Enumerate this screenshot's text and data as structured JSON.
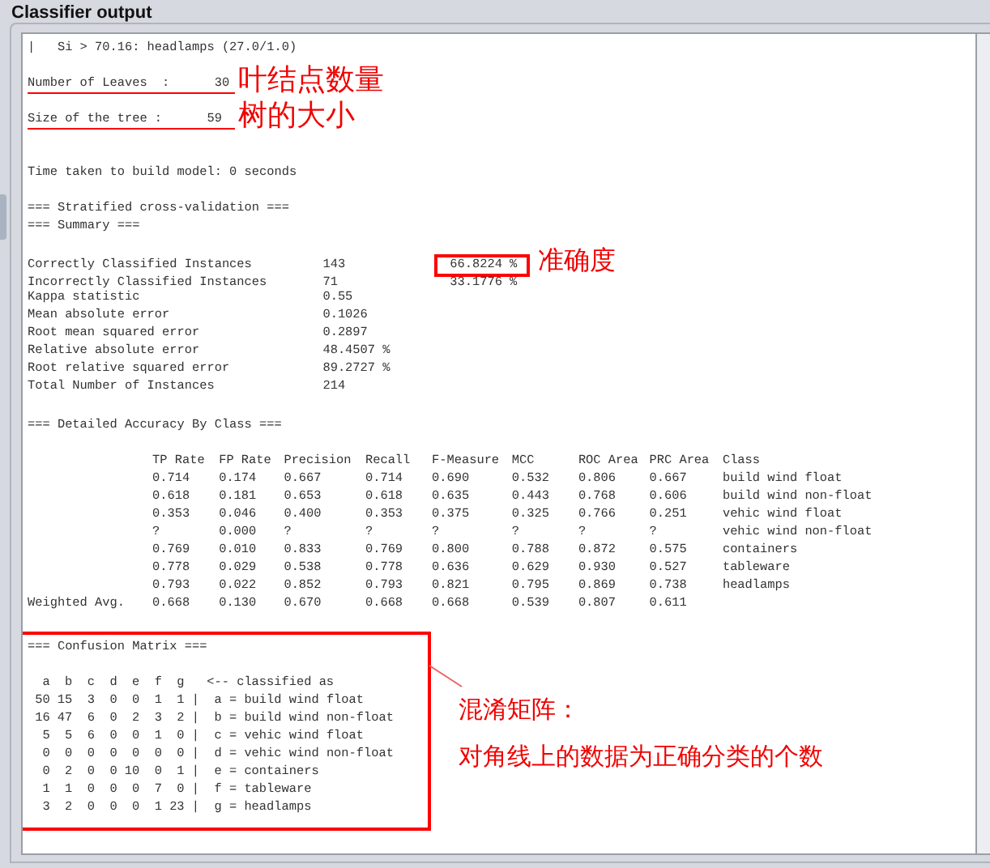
{
  "panel": {
    "title": "Classifier output"
  },
  "tree_lines": [
    "|   Si > 70.16: headlamps (27.0/1.0)"
  ],
  "tree_stats": [
    {
      "label": "Number of Leaves  :",
      "value": "30",
      "underlined": true,
      "note": "叶结点数量"
    },
    {
      "label": "Size of the tree :",
      "value": "59",
      "underlined": true,
      "note": "树的大小"
    }
  ],
  "build_time": "Time taken to build model: 0 seconds",
  "summary": {
    "headings": [
      "=== Stratified cross-validation ===",
      "=== Summary ==="
    ],
    "rows": [
      {
        "label": "Correctly Classified Instances",
        "value": "143",
        "percent": "66.8224 %",
        "highlighted": true
      },
      {
        "label": "Incorrectly Classified Instances",
        "value": "71",
        "percent": "33.1776 %",
        "highlighted": false
      },
      {
        "label": "Kappa statistic",
        "value": "0.55"
      },
      {
        "label": "Mean absolute error",
        "value": "0.1026"
      },
      {
        "label": "Root mean squared error",
        "value": "0.2897"
      },
      {
        "label": "Relative absolute error",
        "value": "48.4507 %"
      },
      {
        "label": "Root relative squared error",
        "value": "89.2727 %"
      },
      {
        "label": "Total Number of Instances",
        "value": "214"
      }
    ],
    "note": "准确度"
  },
  "detailed": {
    "heading": "=== Detailed Accuracy By Class ===",
    "columns": [
      "TP Rate",
      "FP Rate",
      "Precision",
      "Recall",
      "F-Measure",
      "MCC",
      "ROC Area",
      "PRC Area",
      "Class"
    ],
    "rows": [
      {
        "values": [
          "0.714",
          "0.174",
          "0.667",
          "0.714",
          "0.690",
          "0.532",
          "0.806",
          "0.667"
        ],
        "class": "build wind float"
      },
      {
        "values": [
          "0.618",
          "0.181",
          "0.653",
          "0.618",
          "0.635",
          "0.443",
          "0.768",
          "0.606"
        ],
        "class": "build wind non-float"
      },
      {
        "values": [
          "0.353",
          "0.046",
          "0.400",
          "0.353",
          "0.375",
          "0.325",
          "0.766",
          "0.251"
        ],
        "class": "vehic wind float"
      },
      {
        "values": [
          "?",
          "0.000",
          "?",
          "?",
          "?",
          "?",
          "?",
          "?"
        ],
        "class": "vehic wind non-float"
      },
      {
        "values": [
          "0.769",
          "0.010",
          "0.833",
          "0.769",
          "0.800",
          "0.788",
          "0.872",
          "0.575"
        ],
        "class": "containers"
      },
      {
        "values": [
          "0.778",
          "0.029",
          "0.538",
          "0.778",
          "0.636",
          "0.629",
          "0.930",
          "0.527"
        ],
        "class": "tableware"
      },
      {
        "values": [
          "0.793",
          "0.022",
          "0.852",
          "0.793",
          "0.821",
          "0.795",
          "0.869",
          "0.738"
        ],
        "class": "headlamps"
      },
      {
        "label": "Weighted Avg.",
        "values": [
          "0.668",
          "0.130",
          "0.670",
          "0.668",
          "0.668",
          "0.539",
          "0.807",
          "0.611"
        ]
      }
    ]
  },
  "confusion": {
    "title": "=== Confusion Matrix ===",
    "highlighted": true,
    "letters": [
      "a",
      "b",
      "c",
      "d",
      "e",
      "f",
      "g"
    ],
    "legend_heading": "<-- classified as",
    "rows": [
      {
        "values": [
          "50",
          "15",
          "3",
          "0",
          "0",
          "1",
          "1"
        ],
        "legend": "|  a = build wind float"
      },
      {
        "values": [
          "16",
          "47",
          "6",
          "0",
          "2",
          "3",
          "2"
        ],
        "legend": "|  b = build wind non-float"
      },
      {
        "values": [
          "5",
          "5",
          "6",
          "0",
          "0",
          "1",
          "0"
        ],
        "legend": "|  c = vehic wind float"
      },
      {
        "values": [
          "0",
          "0",
          "0",
          "0",
          "0",
          "0",
          "0"
        ],
        "legend": "|  d = vehic wind non-float"
      },
      {
        "values": [
          "0",
          "2",
          "0",
          "0",
          "10",
          "0",
          "1"
        ],
        "legend": "|  e = containers"
      },
      {
        "values": [
          "1",
          "1",
          "0",
          "0",
          "0",
          "7",
          "0"
        ],
        "legend": "|  f = tableware"
      },
      {
        "values": [
          "3",
          "2",
          "0",
          "0",
          "0",
          "1",
          "23"
        ],
        "legend": "|  g = headlamps"
      }
    ],
    "notes": [
      "混淆矩阵：",
      "对角线上的数据为正确分类的个数"
    ]
  }
}
